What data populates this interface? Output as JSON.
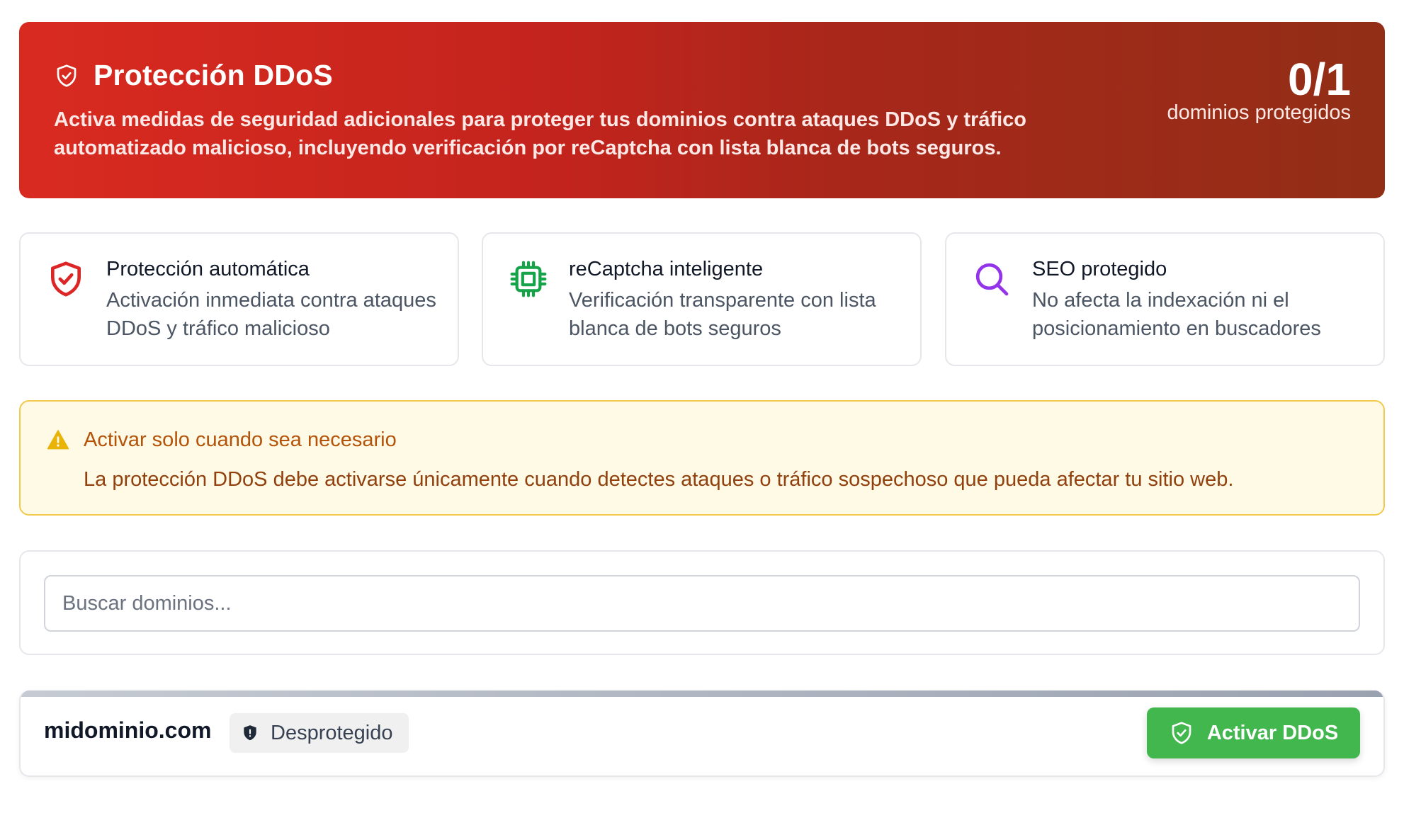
{
  "banner": {
    "icon": "shield-check-icon",
    "title": "Protección DDoS",
    "description": "Activa medidas de seguridad adicionales para proteger tus dominios contra ataques DDoS y tráfico automatizado malicioso, incluyendo verificación por reCaptcha con lista blanca de bots seguros.",
    "count": "0/1",
    "count_label": "dominios protegidos",
    "colors": {
      "start": "#d92a20",
      "end": "#922e16"
    }
  },
  "features": [
    {
      "icon": "shield-check-icon",
      "title": "Protección automática",
      "description": "Activación inmediata contra ataques DDoS y tráfico malicioso",
      "color": "#dc2626"
    },
    {
      "icon": "cpu-chip-icon",
      "title": "reCaptcha inteligente",
      "description": "Verificación transparente con lista blanca de bots seguros",
      "color": "#16a34a"
    },
    {
      "icon": "search-icon",
      "title": "SEO protegido",
      "description": "No afecta la indexación ni el posicionamiento en buscadores",
      "color": "#9333ea"
    }
  ],
  "warning": {
    "icon": "warning-triangle-icon",
    "title": "Activar solo cuando sea necesario",
    "text": "La protección DDoS debe activarse únicamente cuando detectes ataques o tráfico sospechoso que pueda afectar tu sitio web.",
    "color": "#b45309"
  },
  "search": {
    "placeholder": "Buscar dominios...",
    "value": ""
  },
  "domains": [
    {
      "name": "midominio.com",
      "status": "Desprotegido",
      "status_icon": "shield-icon",
      "action_label": "Activar DDoS",
      "action_icon": "shield-check-icon",
      "action_color": "#41b74e"
    }
  ]
}
